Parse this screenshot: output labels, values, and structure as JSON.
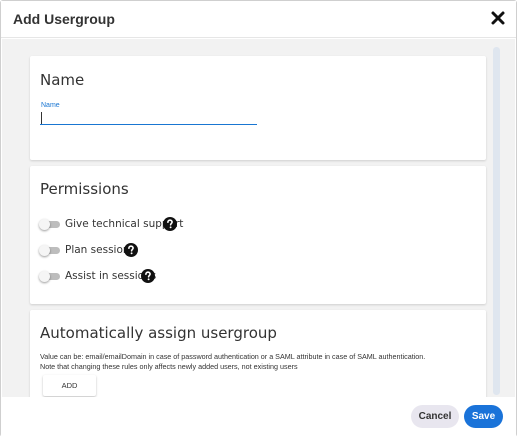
{
  "dialog": {
    "title": "Add Usergroup",
    "close_icon": "close-icon"
  },
  "name_section": {
    "title": "Name",
    "field_label": "Name",
    "field_value": ""
  },
  "permissions": {
    "title": "Permissions",
    "items": [
      {
        "label": "Give technical support",
        "enabled": false,
        "icon": "help-icon"
      },
      {
        "label": "Plan sessions",
        "enabled": false,
        "icon": "help-icon"
      },
      {
        "label": "Assist in sessions",
        "enabled": false,
        "icon": "help-icon"
      }
    ]
  },
  "auto_assign": {
    "title": "Automatically assign usergroup",
    "description_line1": "Value can be: email/emailDomain in case of password authentication or a SAML attribute in case of SAML authentication.",
    "description_line2": "Note that changing these rules only affects newly added users, not existing users",
    "add_label": "ADD"
  },
  "footer": {
    "cancel_label": "Cancel",
    "save_label": "Save"
  },
  "colors": {
    "accent": "#1a73d9",
    "input_underline": "#1976d2",
    "cancel_bg": "#e8e6ef",
    "body_bg": "#f2f2f2"
  }
}
